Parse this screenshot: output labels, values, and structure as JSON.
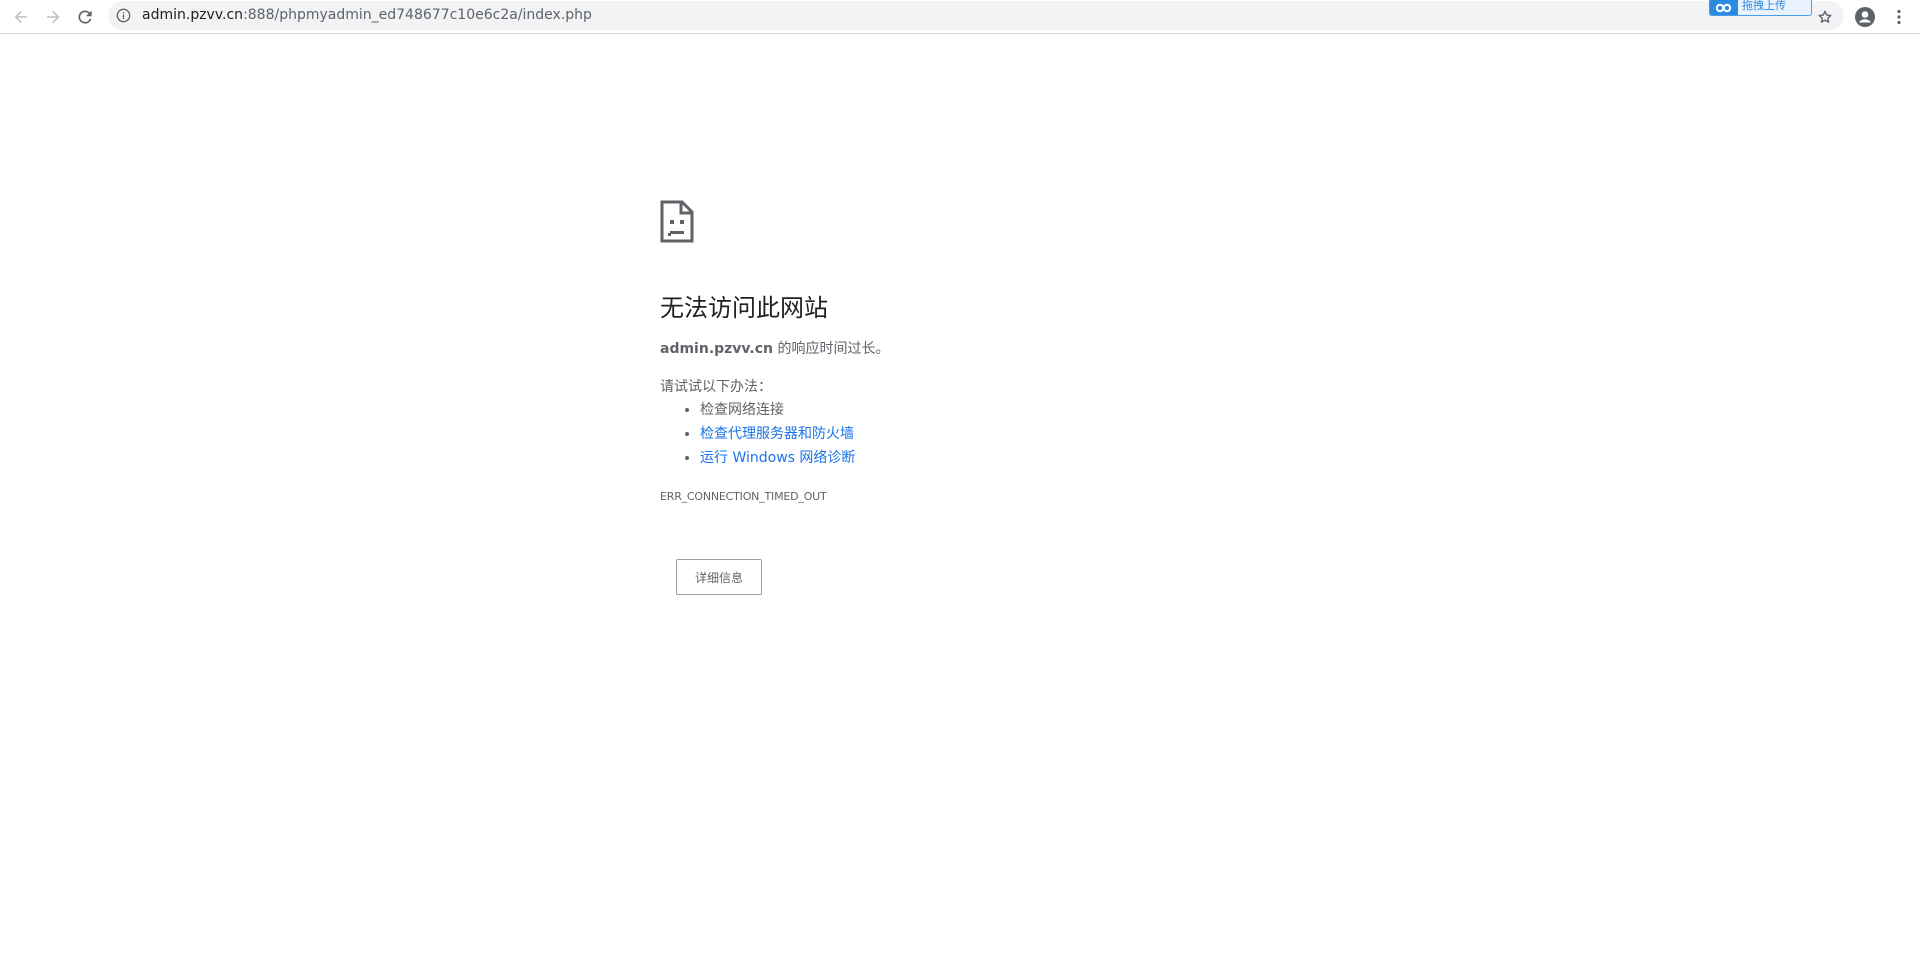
{
  "browser": {
    "back_icon": "arrow-back-icon",
    "forward_icon": "arrow-forward-icon",
    "reload_icon": "reload-icon",
    "info_icon": "info-icon",
    "url_host": "admin.pzvv.cn",
    "url_rest": ":888/phpmyadmin_ed748677c10e6c2a/index.php",
    "extension_label": "拖拽上传",
    "star_icon": "star-icon",
    "account_icon": "account-icon",
    "menu_icon": "kebab-menu-icon"
  },
  "error_page": {
    "icon": "sad-document-icon",
    "heading": "无法访问此网站",
    "host": "admin.pzvv.cn",
    "summary_suffix": " 的响应时间过长。",
    "try_label": "请试试以下办法：",
    "suggestions": [
      "检查网络连接",
      "检查代理服务器和防火墙",
      "运行 Windows 网络诊断"
    ],
    "error_code": "ERR_CONNECTION_TIMED_OUT",
    "details_button": "详细信息"
  },
  "colors": {
    "link": "#1a73e8",
    "text_secondary": "#5f6368",
    "heading": "#202124",
    "omnibox_bg": "#f1f3f4",
    "extension_blue": "#2b8ae2"
  }
}
